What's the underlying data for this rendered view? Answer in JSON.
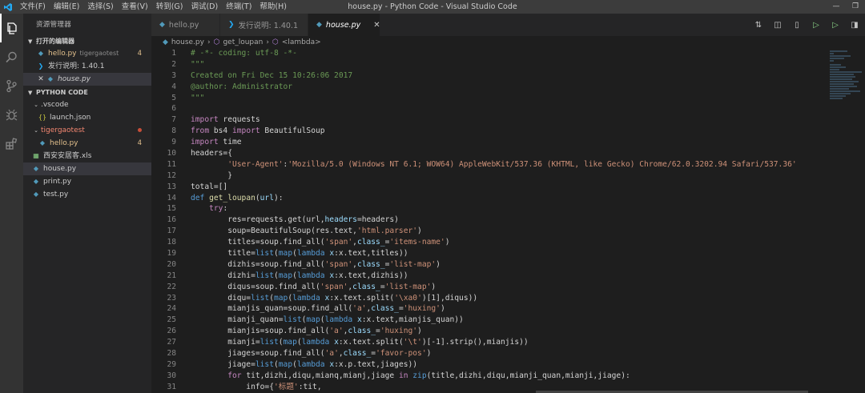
{
  "titlebar": {
    "menu": [
      "文件(F)",
      "编辑(E)",
      "选择(S)",
      "查看(V)",
      "转到(G)",
      "调试(D)",
      "终端(T)",
      "帮助(H)"
    ],
    "title": "house.py - Python Code - Visual Studio Code"
  },
  "sidebar": {
    "title": "资源管理器",
    "open_editors_label": "打开的编辑器",
    "open_editors": [
      {
        "name": "hello.py",
        "desc": "tigergaotest",
        "badge": "4"
      },
      {
        "name": "发行说明: 1.40.1"
      },
      {
        "name": "house.py"
      }
    ],
    "project_label": "PYTHON CODE",
    "tree": {
      "vscode_folder": ".vscode",
      "launch": "launch.json",
      "tiger_folder": "tigergaotest",
      "hello": "hello.py",
      "hello_badge": "4",
      "xls": "西安安居客.xls",
      "house": "house.py",
      "print": "print.py",
      "test": "test.py"
    }
  },
  "tabs": [
    {
      "label": "hello.py"
    },
    {
      "label": "发行说明: 1.40.1"
    },
    {
      "label": "house.py"
    }
  ],
  "breadcrumb": {
    "file": "house.py",
    "func": "get_loupan",
    "lambda": "<lambda>"
  },
  "colors": {
    "editor_bg": "#1e1e1e",
    "sidebar_bg": "#252526",
    "activity_bg": "#333333",
    "accent_blue": "#007acc"
  }
}
